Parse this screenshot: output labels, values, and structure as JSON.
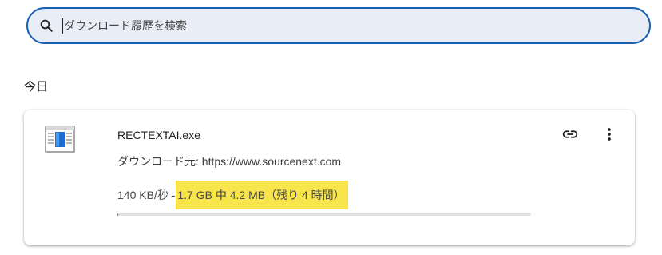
{
  "search": {
    "placeholder": "ダウンロード履歴を検索",
    "value": ""
  },
  "section": {
    "title": "今日"
  },
  "download": {
    "file_name": "RECTEXTAI.exe",
    "source_label": "ダウンロード元: https://www.sourcenext.com",
    "speed_text": "140 KB/秒 - ",
    "status_text": "1.7 GB 中 4.2 MB（残り 4 時間）",
    "progress_fraction": 0.0025,
    "file_icon": "window-file-icon",
    "actions": {
      "copy_link_icon": "link-icon",
      "more_icon": "more-vert-icon"
    }
  },
  "colors": {
    "accent": "#1a5fb4",
    "search_bg": "#e9eef6",
    "highlight": "#f8e44b",
    "progress_track": "#e0e0e0"
  }
}
